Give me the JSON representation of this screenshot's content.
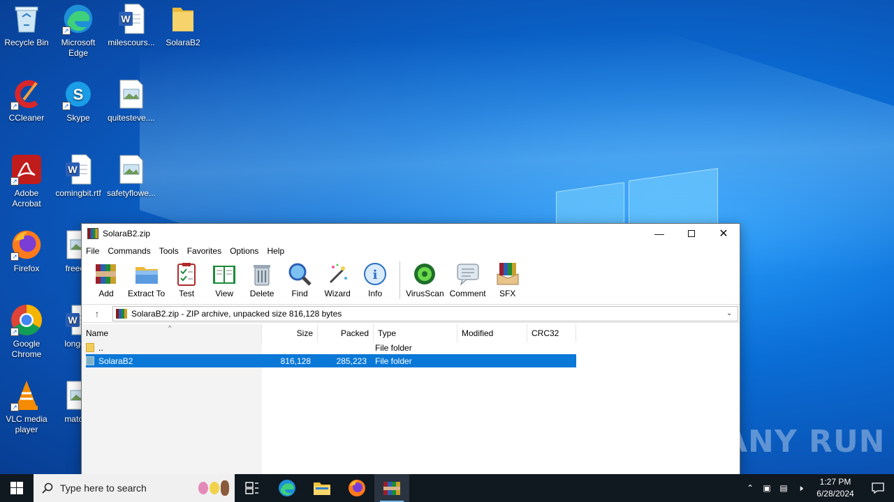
{
  "desktop": {
    "icons": [
      {
        "label": "Recycle Bin",
        "icon": "recycle-bin-icon"
      },
      {
        "label": "Microsoft Edge",
        "icon": "edge-icon"
      },
      {
        "label": "milescours...",
        "icon": "word-document-icon"
      },
      {
        "label": "SolaraB2",
        "icon": "folder-icon"
      },
      {
        "label": "CCleaner",
        "icon": "ccleaner-icon"
      },
      {
        "label": "Skype",
        "icon": "skype-icon"
      },
      {
        "label": "quitesteve....",
        "icon": "image-file-icon"
      },
      {
        "label": "Adobe Acrobat",
        "icon": "acrobat-icon"
      },
      {
        "label": "comingbit.rtf",
        "icon": "word-document-icon"
      },
      {
        "label": "safetyflowe...",
        "icon": "image-file-icon"
      },
      {
        "label": "Firefox",
        "icon": "firefox-icon"
      },
      {
        "label": "freeeyt",
        "icon": "image-file-icon"
      },
      {
        "label": "Google Chrome",
        "icon": "chrome-icon"
      },
      {
        "label": "longers",
        "icon": "word-document-icon"
      },
      {
        "label": "VLC media player",
        "icon": "vlc-icon"
      },
      {
        "label": "matchp",
        "icon": "image-file-icon"
      }
    ]
  },
  "window": {
    "title": "SolaraB2.zip",
    "menu": [
      "File",
      "Commands",
      "Tools",
      "Favorites",
      "Options",
      "Help"
    ],
    "toolbar": [
      {
        "label": "Add",
        "icon": "add-archive-icon"
      },
      {
        "label": "Extract To",
        "icon": "extract-folder-icon"
      },
      {
        "label": "Test",
        "icon": "test-checklist-icon"
      },
      {
        "label": "View",
        "icon": "view-book-icon"
      },
      {
        "label": "Delete",
        "icon": "trash-icon"
      },
      {
        "label": "Find",
        "icon": "magnifier-icon"
      },
      {
        "label": "Wizard",
        "icon": "wand-icon"
      },
      {
        "label": "Info",
        "icon": "info-icon"
      },
      {
        "label": "VirusScan",
        "icon": "virus-icon"
      },
      {
        "label": "Comment",
        "icon": "comment-icon"
      },
      {
        "label": "SFX",
        "icon": "sfx-box-icon"
      }
    ],
    "address": "SolaraB2.zip - ZIP archive, unpacked size 816,128 bytes",
    "columns": [
      "Name",
      "Size",
      "Packed",
      "Type",
      "Modified",
      "CRC32"
    ],
    "rows": [
      {
        "name": "..",
        "size": "",
        "packed": "",
        "type": "File folder",
        "modified": "",
        "crc": ""
      },
      {
        "name": "SolaraB2",
        "size": "816,128",
        "packed": "285,223",
        "type": "File folder",
        "modified": "",
        "crc": ""
      }
    ]
  },
  "taskbar": {
    "search_placeholder": "Type here to search",
    "time": "1:27 PM",
    "date": "6/28/2024"
  },
  "watermark": "ANY RUN"
}
